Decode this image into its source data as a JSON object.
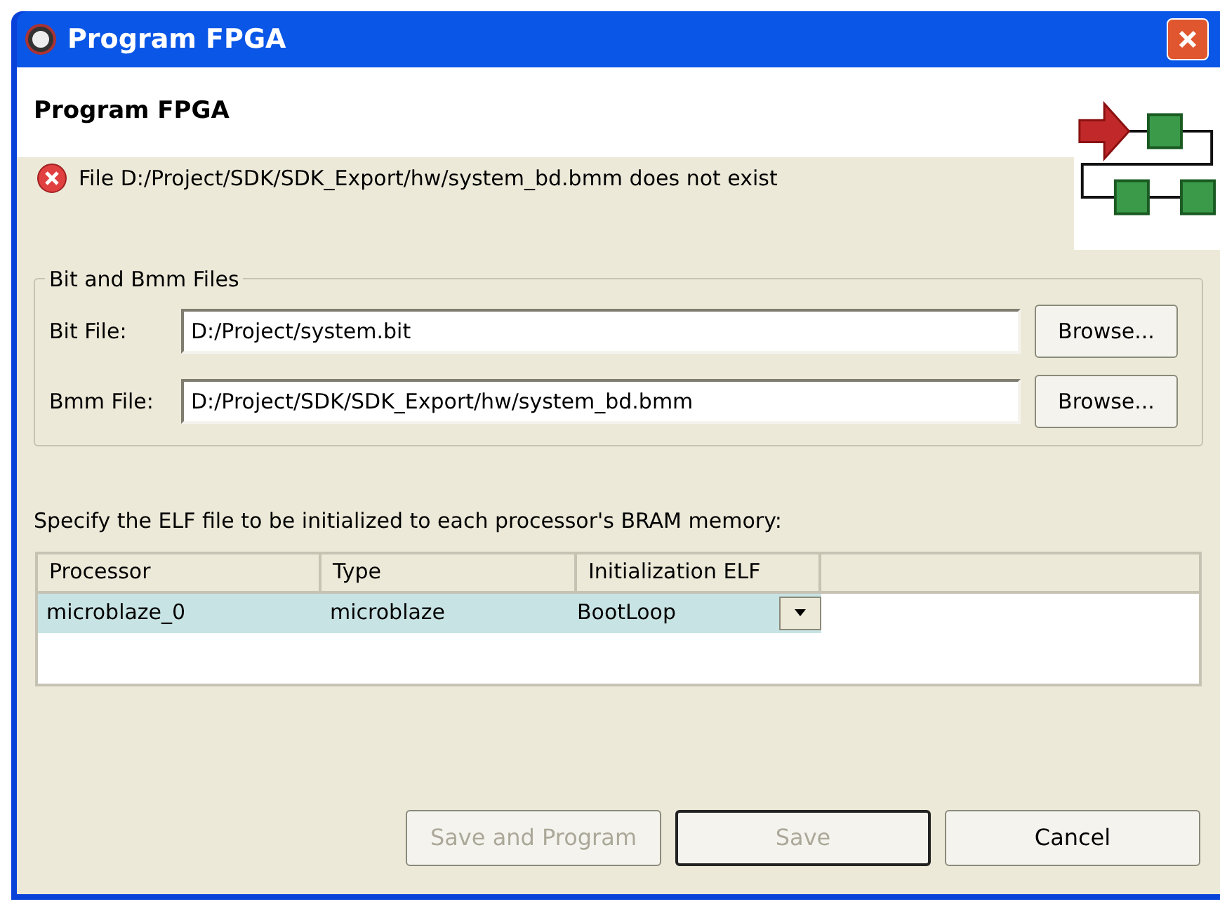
{
  "window": {
    "title": "Program FPGA"
  },
  "header": {
    "title": "Program FPGA",
    "message": {
      "kind": "error",
      "text": "File D:/Project/SDK/SDK_Export/hw/system_bd.bmm does not exist"
    }
  },
  "files_group": {
    "title": "Bit and Bmm Files",
    "rows": [
      {
        "label": "Bit File:",
        "value": "D:/Project/system.bit",
        "button": "Browse..."
      },
      {
        "label": "Bmm File:",
        "value": "D:/Project/SDK/SDK_Export/hw/system_bd.bmm",
        "button": "Browse..."
      }
    ]
  },
  "instruction": "Specify the ELF file to be initialized to each processor's BRAM memory:",
  "table": {
    "columns": [
      "Processor",
      "Type",
      "Initialization ELF"
    ],
    "rows": [
      {
        "processor": "microblaze_0",
        "type": "microblaze",
        "elf": "BootLoop",
        "selected": true
      }
    ]
  },
  "buttons": [
    {
      "label": "Save and Program",
      "disabled": true,
      "default": false
    },
    {
      "label": "Save",
      "disabled": true,
      "default": true
    },
    {
      "label": "Cancel",
      "disabled": false,
      "default": false
    }
  ]
}
